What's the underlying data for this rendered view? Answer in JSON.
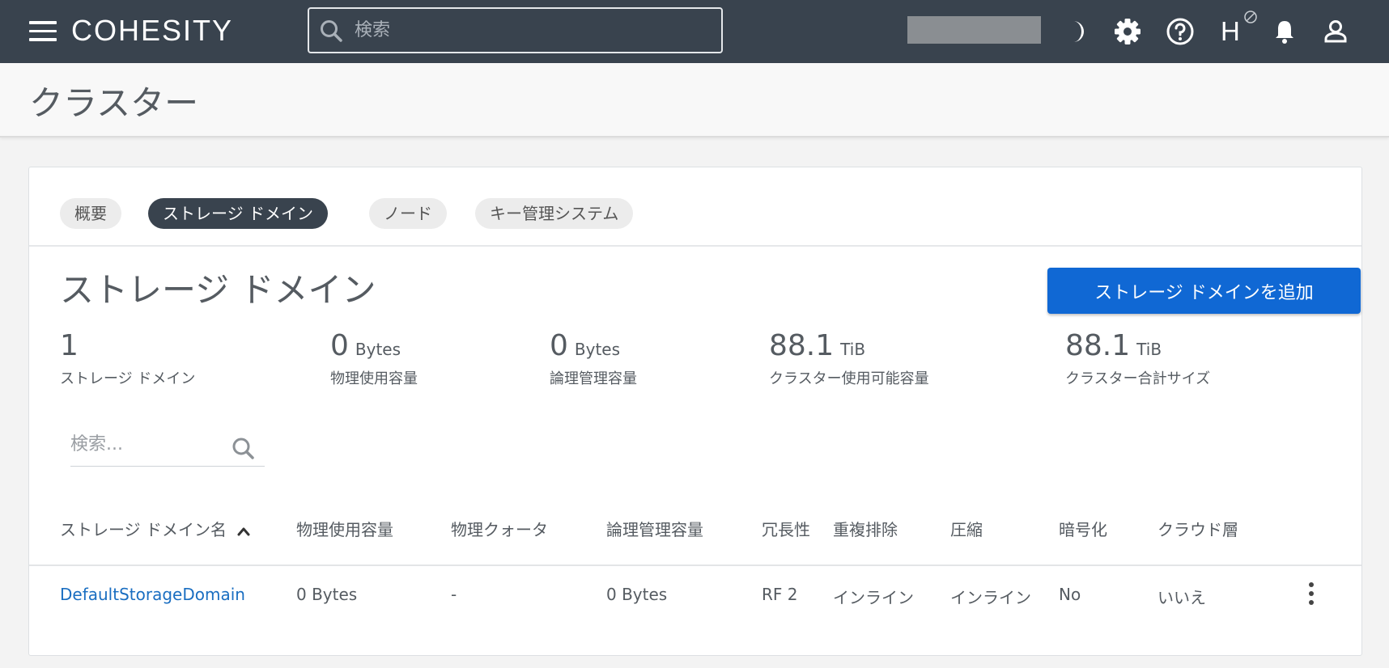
{
  "header": {
    "logo_text": "COHESITY",
    "search_placeholder": "検索",
    "user_initial": "H"
  },
  "page": {
    "title": "クラスター"
  },
  "tabs": [
    {
      "label": "概要",
      "active": false
    },
    {
      "label": "ストレージ ドメイン",
      "active": true
    },
    {
      "label": "ノード",
      "active": false
    },
    {
      "label": "キー管理システム",
      "active": false
    }
  ],
  "section": {
    "title": "ストレージ ドメイン",
    "add_button_label": "ストレージ ドメインを追加"
  },
  "stats": [
    {
      "value": "1",
      "unit": "",
      "label": "ストレージ ドメイン"
    },
    {
      "value": "0",
      "unit": "Bytes",
      "label": "物理使用容量"
    },
    {
      "value": "0",
      "unit": "Bytes",
      "label": "論理管理容量"
    },
    {
      "value": "88.1",
      "unit": "TiB",
      "label": "クラスター使用可能容量"
    },
    {
      "value": "88.1",
      "unit": "TiB",
      "label": "クラスター合計サイズ"
    }
  ],
  "table": {
    "search_placeholder": "検索...",
    "columns": [
      "ストレージ ドメイン名",
      "物理使用容量",
      "物理クォータ",
      "論理管理容量",
      "冗長性",
      "重複排除",
      "圧縮",
      "暗号化",
      "クラウド層"
    ],
    "rows": [
      [
        "DefaultStorageDomain",
        "0 Bytes",
        "-",
        "0 Bytes",
        "RF 2",
        "インライン",
        "インライン",
        "No",
        "いいえ"
      ]
    ]
  },
  "colors": {
    "topbar": "#39434e",
    "primary_button": "#1068d4",
    "link": "#1a6ec1",
    "active_tab": "#39434e"
  },
  "icons": {
    "menu": "hamburger-icon",
    "search": "search-icon",
    "theme": "moon-icon",
    "settings": "gear-icon",
    "help": "help-icon",
    "notifications": "bell-icon",
    "user": "user-icon",
    "sort": "chevron-up-icon",
    "row_actions": "kebab-menu-icon"
  }
}
